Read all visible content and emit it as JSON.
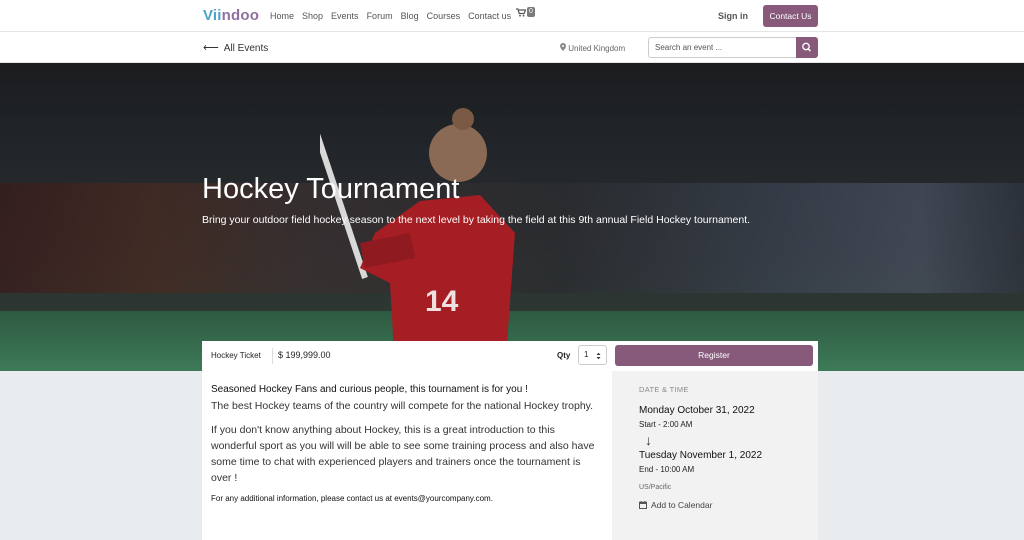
{
  "nav": {
    "logo_part1": "Vii",
    "logo_part2": "ndoo",
    "links": [
      "Home",
      "Shop",
      "Events",
      "Forum",
      "Blog",
      "Courses",
      "Contact us"
    ],
    "cart_count": "0",
    "signin": "Sign in",
    "contact_button": "Contact Us"
  },
  "subbar": {
    "back_label": "All Events",
    "location": "United Kingdom",
    "search_placeholder": "Search an event ..."
  },
  "hero": {
    "title": "Hockey Tournament",
    "subtitle": "Bring your outdoor field hockey season to the next level by taking the field at this 9th annual Field Hockey tournament."
  },
  "ticket": {
    "name": "Hockey Ticket",
    "price": "$ 199,999.00",
    "qty_label": "Qty",
    "qty_value": "1",
    "register_label": "Register"
  },
  "description": {
    "lead": "Seasoned Hockey Fans and curious people, this tournament is for you !",
    "para1": "The best Hockey teams of the country will compete for the national Hockey trophy.",
    "para2": "If you don't know anything about Hockey, this is a great introduction to this wonderful sport as you will will be able to see some training process and also have some time to chat with experienced players and trainers once the tournament is over !",
    "contact_text": "For any additional information, please contact us at ",
    "contact_email": "events@yourcompany.com",
    "contact_end": "."
  },
  "schedule": {
    "caption": "DATE & TIME",
    "start_date": "Monday October 31, 2022",
    "start_time": "Start - 2:00 AM",
    "end_date": "Tuesday November 1, 2022",
    "end_time": "End - 10:00 AM",
    "timezone": "US/Pacific",
    "calendar_label": "Add to Calendar"
  },
  "colors": {
    "primary": "#875a7b",
    "logo_blue": "#4aa3c8"
  }
}
